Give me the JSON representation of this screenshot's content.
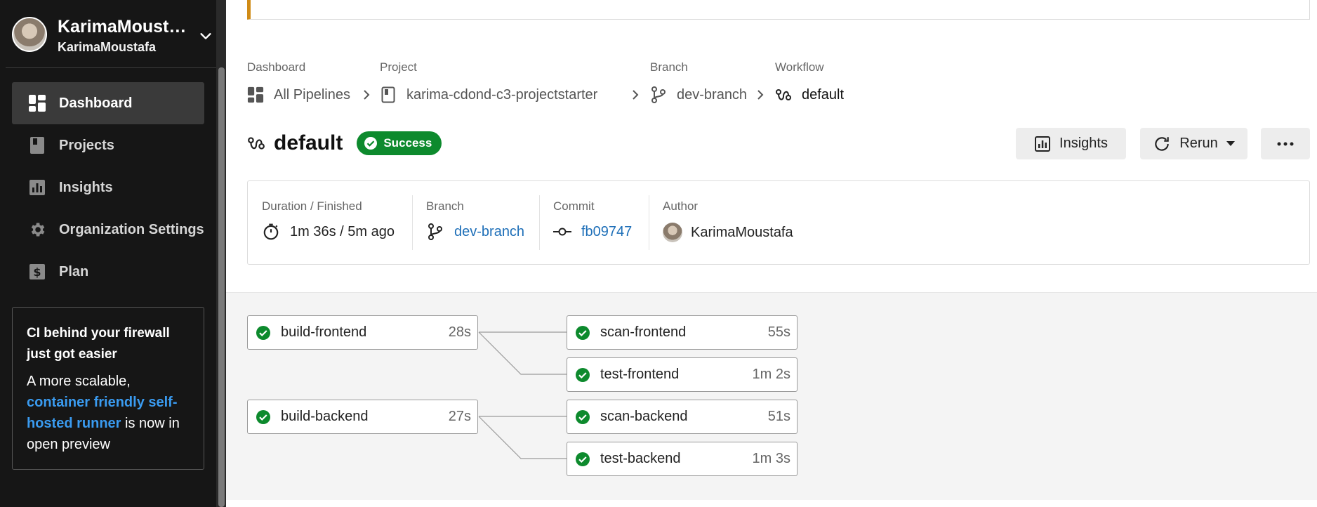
{
  "user": {
    "display_name": "KarimaMoustafa",
    "username": "KarimaMoustafa"
  },
  "sidebar": {
    "items": [
      {
        "label": "Dashboard",
        "icon": "dashboard-icon",
        "active": true
      },
      {
        "label": "Projects",
        "icon": "project-icon",
        "active": false
      },
      {
        "label": "Insights",
        "icon": "insights-icon",
        "active": false
      },
      {
        "label": "Organization Settings",
        "icon": "gear-icon",
        "active": false
      },
      {
        "label": "Plan",
        "icon": "dollar-icon",
        "active": false
      }
    ],
    "promo": {
      "title": "CI behind your firewall just got easier",
      "text_before": "A more scalable, ",
      "link": "container friendly self-hosted runner",
      "text_after": " is now in open preview"
    }
  },
  "breadcrumb": {
    "dashboard": {
      "label": "Dashboard",
      "value": "All Pipelines"
    },
    "project": {
      "label": "Project",
      "value": "karima-cdond-c3-projectstarter"
    },
    "branch": {
      "label": "Branch",
      "value": "dev-branch"
    },
    "workflow": {
      "label": "Workflow",
      "value": "default"
    }
  },
  "header": {
    "title": "default",
    "status": "Success",
    "insights_label": "Insights",
    "rerun_label": "Rerun"
  },
  "info": {
    "duration": {
      "label": "Duration / Finished",
      "value": "1m 36s / 5m ago"
    },
    "branch": {
      "label": "Branch",
      "value": "dev-branch"
    },
    "commit": {
      "label": "Commit",
      "value": "fb09747"
    },
    "author": {
      "label": "Author",
      "value": "KarimaMoustafa"
    }
  },
  "jobs": [
    {
      "name": "build-frontend",
      "duration": "28s",
      "status": "success"
    },
    {
      "name": "scan-frontend",
      "duration": "55s",
      "status": "success"
    },
    {
      "name": "test-frontend",
      "duration": "1m 2s",
      "status": "success"
    },
    {
      "name": "build-backend",
      "duration": "27s",
      "status": "success"
    },
    {
      "name": "scan-backend",
      "duration": "51s",
      "status": "success"
    },
    {
      "name": "test-backend",
      "duration": "1m 3s",
      "status": "success"
    }
  ],
  "colors": {
    "success": "#0d8a2d",
    "link": "#1e6fb8",
    "sidebar_bg": "#161616",
    "banner_accent": "#d08b16"
  }
}
